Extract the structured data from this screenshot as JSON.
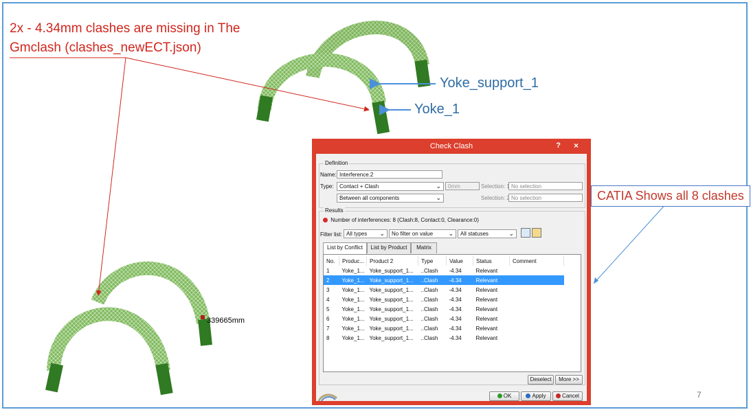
{
  "slide": {
    "note_line1": "2x - 4.34mm clashes are missing in The",
    "note_line2": "Gmclash (clashes_newECT.json)",
    "label_yoke_support": "Yoke_support_1",
    "label_yoke": "Yoke_1",
    "catia_note": "CATIA Shows all 8 clashes",
    "dimension_label": "339665mm",
    "page_number": "7"
  },
  "colors": {
    "note_red": "#d0261d",
    "label_blue": "#2e6da4",
    "dialog_frame": "#dc3f2d",
    "selection": "#3399ff",
    "part_green": "#3d8b2e"
  },
  "dialog": {
    "title": "Check Clash",
    "help": "?",
    "close": "×",
    "definition": {
      "group_label": "Definition",
      "name_label": "Name:",
      "name_value": "Interference.2",
      "type_label": "Type:",
      "type_value": "Contact + Clash",
      "clearance_value": "0mm",
      "scope_value": "Between all components",
      "selection1_label": "Selection: 1",
      "selection1_value": "No selection",
      "selection2_label": "Selection: 2",
      "selection2_value": "No selection"
    },
    "results": {
      "group_label": "Results",
      "summary": "Number of interferences: 8 (Clash:8, Contact:0, Clearance:0)",
      "filter_label": "Filter list:",
      "filter_type": "All types",
      "filter_value": "No filter on value",
      "filter_status": "All statuses"
    },
    "tabs": [
      "List by Conflict",
      "List by Product",
      "Matrix"
    ],
    "columns": [
      "No.",
      "Produc...",
      "Product 2",
      "Type",
      "Value",
      "Status",
      "Comment"
    ],
    "rows": [
      {
        "no": "1",
        "p1": "Yoke_1...",
        "p2": "Yoke_support_1...",
        "type": "..Clash",
        "value": "-4.34",
        "status": "Relevant",
        "comment": ""
      },
      {
        "no": "2",
        "p1": "Yoke_1...",
        "p2": "Yoke_support_1...",
        "type": "..Clash",
        "value": "-4.34",
        "status": "Relevant",
        "comment": ""
      },
      {
        "no": "3",
        "p1": "Yoke_1...",
        "p2": "Yoke_support_1...",
        "type": "..Clash",
        "value": "-4.34",
        "status": "Relevant",
        "comment": ""
      },
      {
        "no": "4",
        "p1": "Yoke_1...",
        "p2": "Yoke_support_1...",
        "type": "..Clash",
        "value": "-4.34",
        "status": "Relevant",
        "comment": ""
      },
      {
        "no": "5",
        "p1": "Yoke_1...",
        "p2": "Yoke_support_1...",
        "type": "..Clash",
        "value": "-4.34",
        "status": "Relevant",
        "comment": ""
      },
      {
        "no": "6",
        "p1": "Yoke_1...",
        "p2": "Yoke_support_1...",
        "type": "..Clash",
        "value": "-4.34",
        "status": "Relevant",
        "comment": ""
      },
      {
        "no": "7",
        "p1": "Yoke_1...",
        "p2": "Yoke_support_1...",
        "type": "..Clash",
        "value": "-4.34",
        "status": "Relevant",
        "comment": ""
      },
      {
        "no": "8",
        "p1": "Yoke_1...",
        "p2": "Yoke_support_1...",
        "type": "..Clash",
        "value": "-4.34",
        "status": "Relevant",
        "comment": ""
      }
    ],
    "selected_row": "2",
    "buttons": {
      "deselect": "Deselect",
      "more": "More >>",
      "ok": "OK",
      "apply": "Apply",
      "cancel": "Cancel"
    }
  }
}
